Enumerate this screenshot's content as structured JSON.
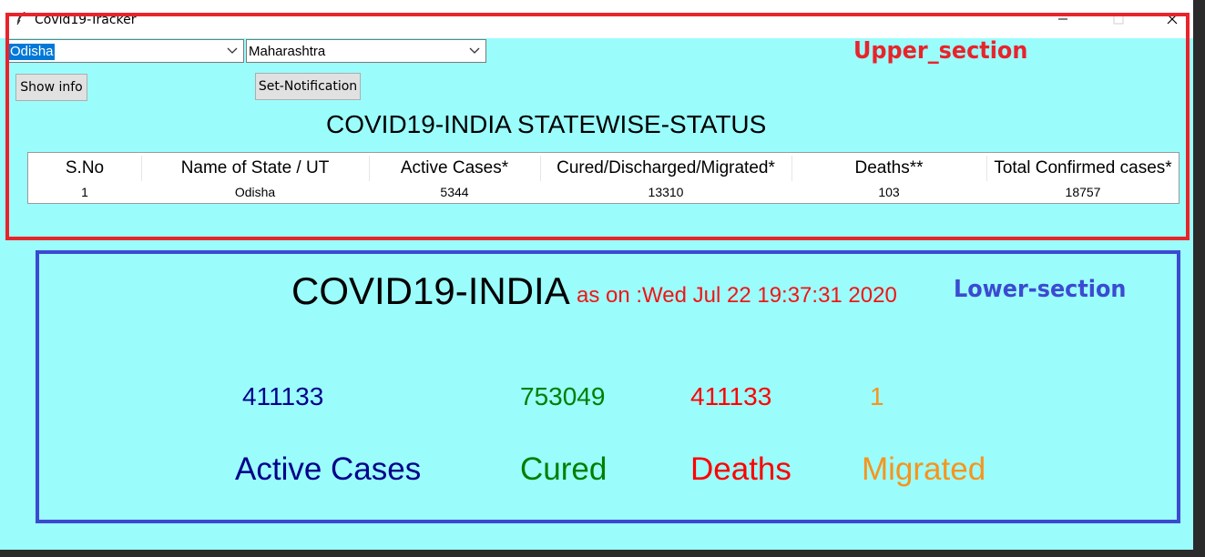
{
  "window": {
    "title": "Covid19-Tracker"
  },
  "controls": {
    "state_select_1": "Odisha",
    "state_select_2": "Maharashtra",
    "show_info_label": "Show info",
    "notification_label": "Set-Notification"
  },
  "upper": {
    "heading": "COVID19-INDIA STATEWISE-STATUS",
    "table": {
      "headers": [
        "S.No",
        "Name of State / UT",
        "Active Cases*",
        "Cured/Discharged/Migrated*",
        "Deaths**",
        "Total Confirmed cases*"
      ],
      "row": [
        "1",
        "Odisha",
        "5344",
        "13310",
        "103",
        "18757"
      ]
    }
  },
  "lower": {
    "title": "COVID19-INDIA",
    "as_on": "as on :Wed Jul 22 19:37:31 2020",
    "stats": [
      {
        "value": "411133",
        "label": "Active Cases",
        "color": "#00008b"
      },
      {
        "value": "753049",
        "label": "Cured",
        "color": "#008000"
      },
      {
        "value": "411133",
        "label": "Deaths",
        "color": "#ff0000"
      },
      {
        "value": "1",
        "label": "Migrated",
        "color": "#f7941d"
      }
    ]
  },
  "annotations": {
    "upper_label": "Upper_section",
    "lower_label": "Lower-section",
    "upper_color": "#e8242b",
    "lower_color": "#3a4bd1"
  }
}
